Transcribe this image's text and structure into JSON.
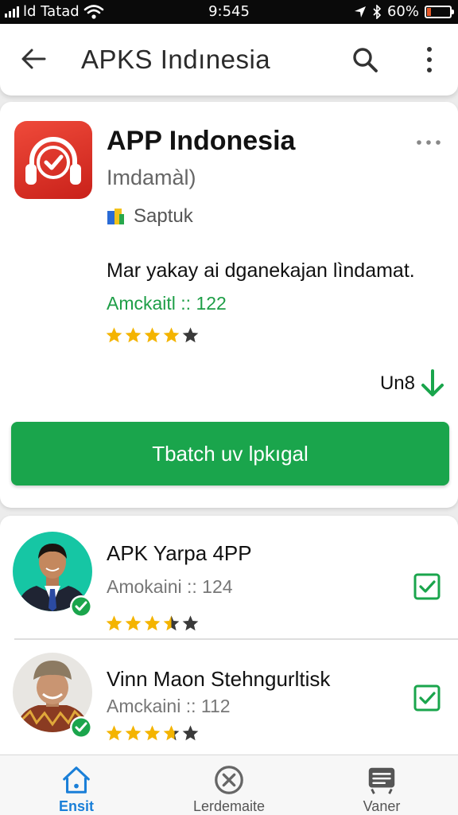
{
  "status_bar": {
    "carrier": "ld Tatad",
    "time": "9:545",
    "battery": "60%",
    "battery_level": 0.18
  },
  "app_bar": {
    "title": "APKS Indınesia",
    "icons": [
      "back-arrow-icon",
      "search-icon",
      "more-vert-icon"
    ]
  },
  "app_card": {
    "icon": "headphones-check-icon",
    "name": "APP Indonesia",
    "subtitle": "Imdamàl)",
    "developer": "Saptuk",
    "description": "Mar yakay ai dganekajan lìndamat.",
    "amount": "Amckaitl :: 122",
    "rating": 4,
    "download_label": "Un8",
    "install_label": "Tbatch uv lpkıgal"
  },
  "list": [
    {
      "name": "APK Yarpa 4PP",
      "count": "Amokaini :: 124",
      "rating": 3.5,
      "verified": true,
      "checked": true
    },
    {
      "name": "Vinn  Maon Stehngurltisk",
      "count": "Amckaini :: 112",
      "rating": 3.7,
      "verified": true,
      "checked": true
    }
  ],
  "bottom_nav": [
    {
      "label": "Ensit",
      "icon": "home-icon",
      "active": true
    },
    {
      "label": "Lerdemaite",
      "icon": "cancel-icon",
      "active": false
    },
    {
      "label": "Vaner",
      "icon": "list-icon",
      "active": false
    }
  ],
  "colors": {
    "accent_green": "#1aa54c",
    "app_icon_red": "#e23b2e",
    "star": "#f4b400",
    "nav_active": "#1a7fd8"
  }
}
